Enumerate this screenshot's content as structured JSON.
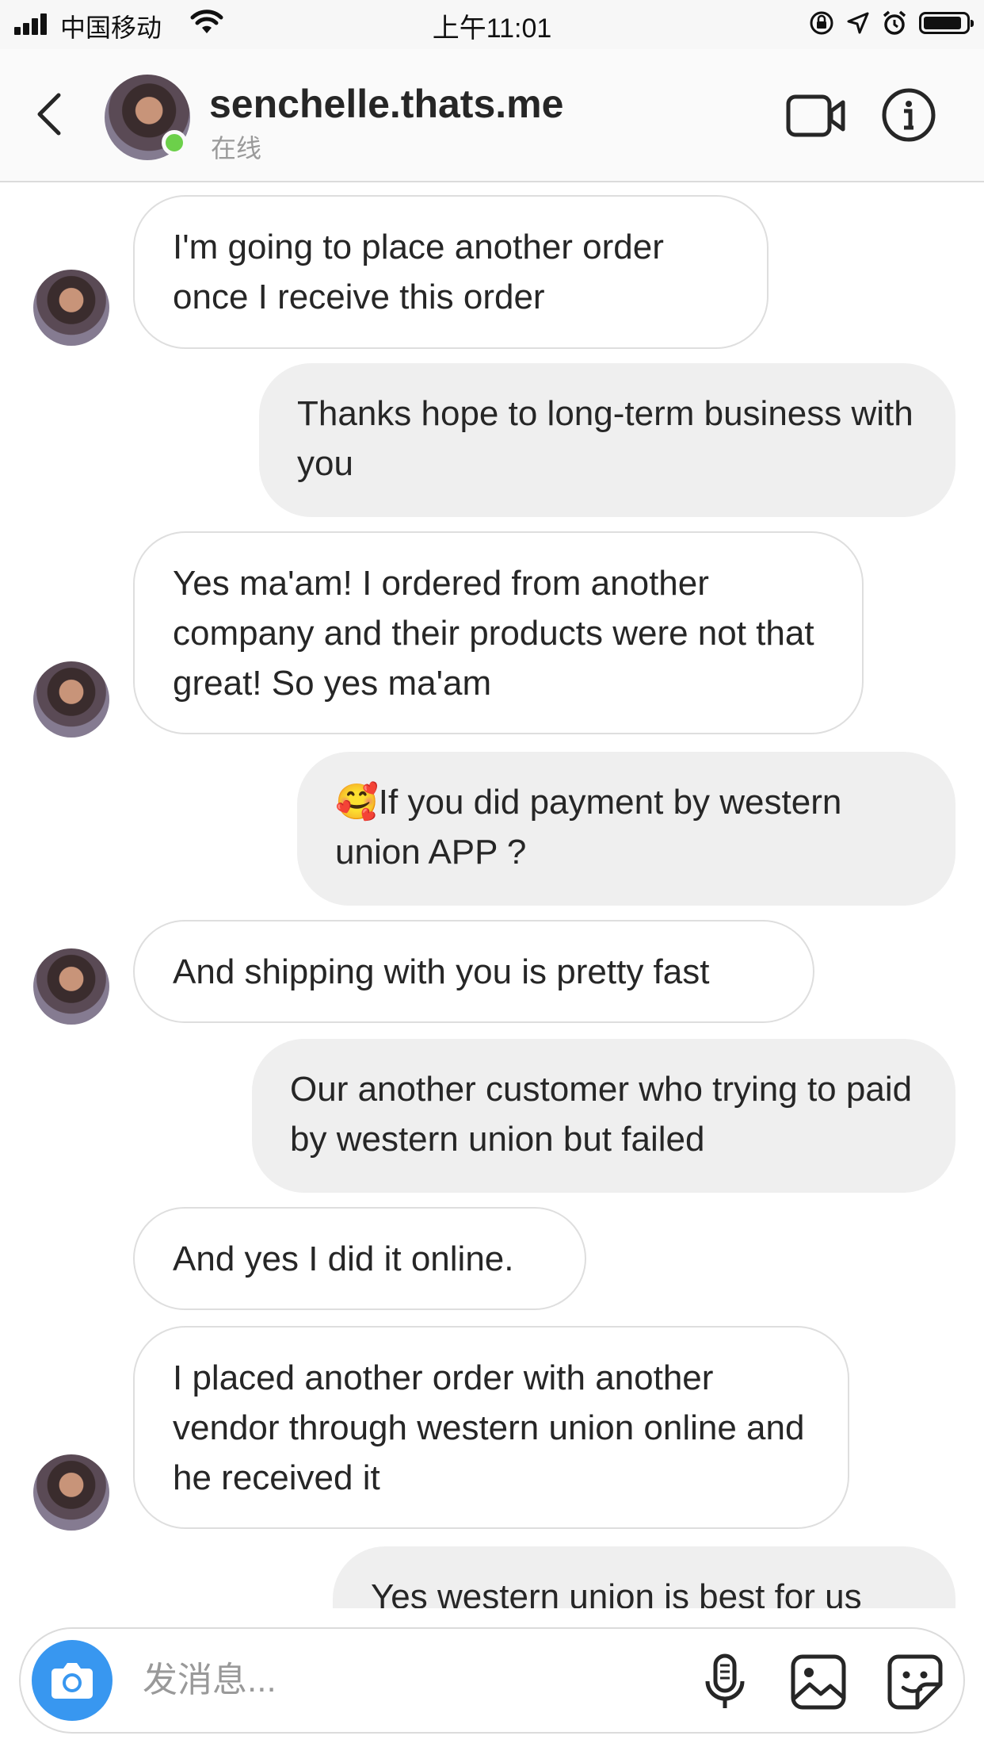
{
  "status_bar": {
    "carrier": "中国移动",
    "time": "上午11:01",
    "battery_level": 0.9
  },
  "header": {
    "username": "senchelle.thats.me",
    "status": "在线",
    "icons": [
      "back-chevron-icon",
      "video-call-icon",
      "info-icon"
    ]
  },
  "messages": [
    {
      "side": "in",
      "text": "I'm going to place another order once I receive this order"
    },
    {
      "side": "out",
      "text": "Thanks hope to long-term business with you"
    },
    {
      "side": "in",
      "text": "Yes ma'am! I ordered from another company and their products were not that great! So yes ma'am"
    },
    {
      "side": "out",
      "emoji": "🥰",
      "text": "If you did payment by western union APP ?"
    },
    {
      "side": "in",
      "text": "And shipping with you is pretty fast"
    },
    {
      "side": "out",
      "text": "Our another customer who trying to paid by western union but failed"
    },
    {
      "side": "in",
      "text": "And yes I did it online."
    },
    {
      "side": "in",
      "text": "I placed another order with another vendor through western union online and he received it"
    },
    {
      "side": "out",
      "text": "Yes western union is best for us"
    }
  ],
  "composer": {
    "placeholder": "发消息...",
    "icons": [
      "camera-icon",
      "microphone-icon",
      "gallery-icon",
      "sticker-icon"
    ]
  },
  "colors": {
    "accent_blue": "#3897f0",
    "online_green": "#6cd04a",
    "outgoing_bubble": "#efefef",
    "incoming_border": "#dedede"
  }
}
